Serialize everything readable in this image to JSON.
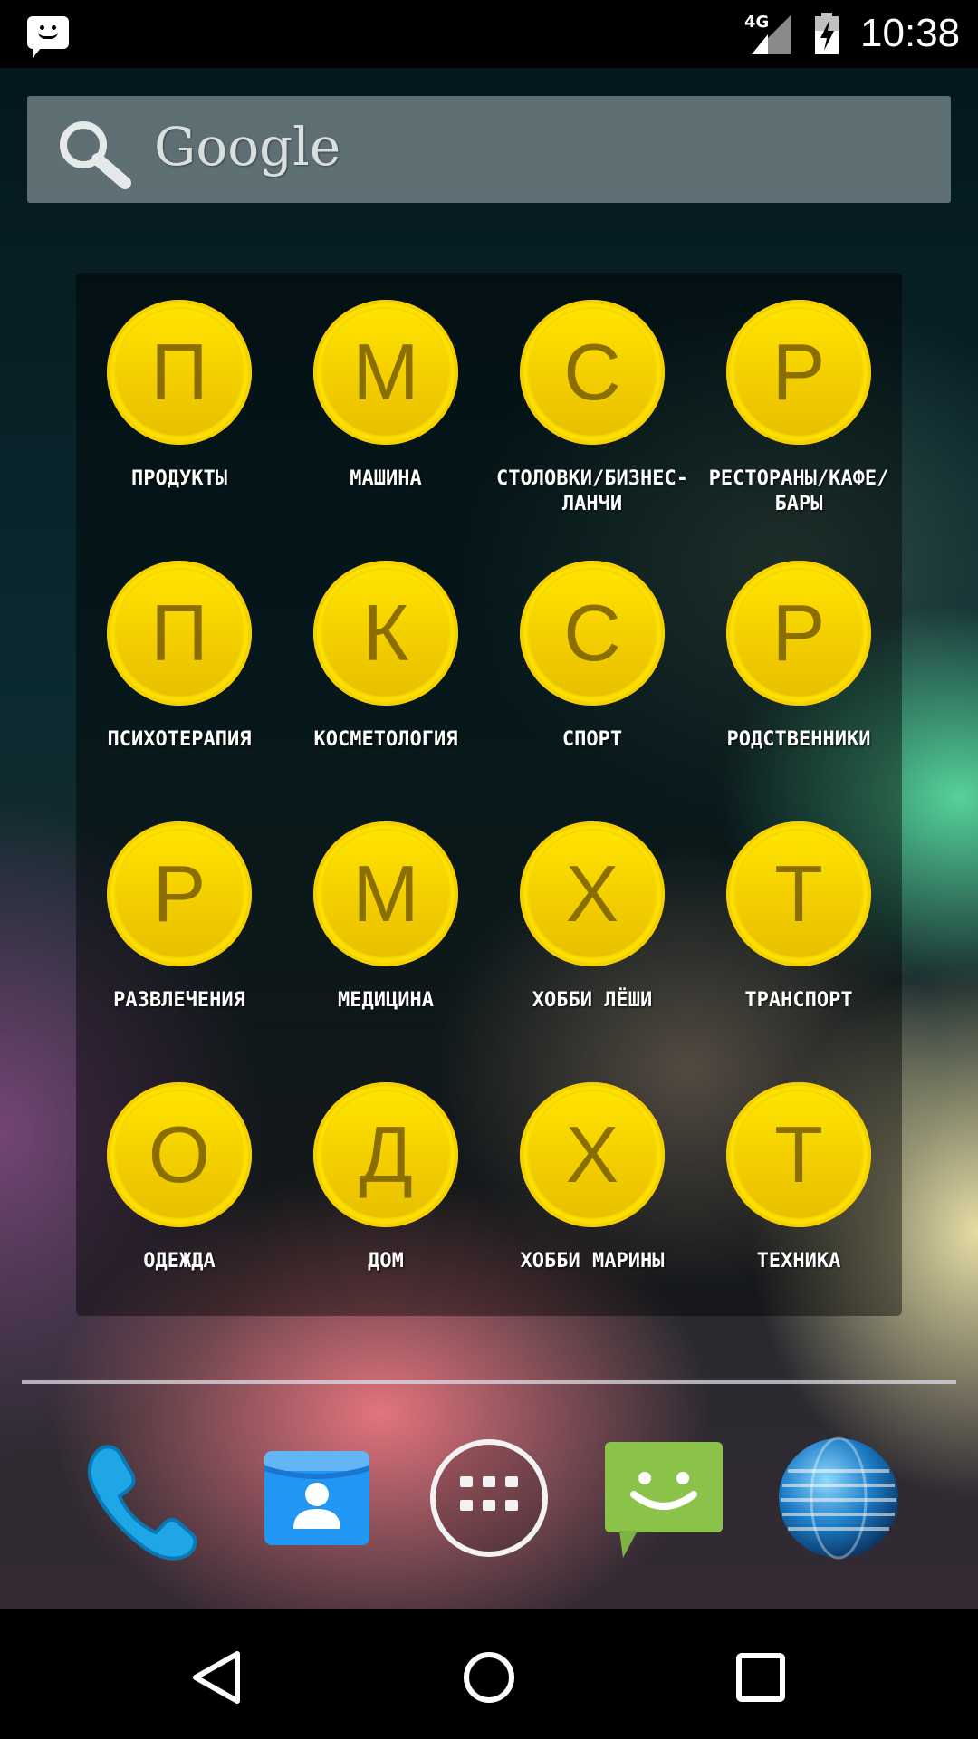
{
  "status_bar": {
    "network": "4G",
    "time": "10:38",
    "notification_icon": "message-icon",
    "signal_icon": "signal-icon",
    "battery_icon": "battery-charging-icon"
  },
  "search": {
    "label": "Google",
    "icon": "search-icon"
  },
  "folder": {
    "accent_color": "#ffe100",
    "apps": [
      {
        "letter": "П",
        "label": "ПРОДУКТЫ"
      },
      {
        "letter": "М",
        "label": "МАШИНА"
      },
      {
        "letter": "С",
        "label": "СТОЛОВКИ/БИЗНЕС-\nЛАНЧИ"
      },
      {
        "letter": "Р",
        "label": "РЕСТОРАНЫ/КАФЕ/\nБАРЫ"
      },
      {
        "letter": "П",
        "label": "ПСИХОТЕРАПИЯ"
      },
      {
        "letter": "К",
        "label": "КОСМЕТОЛОГИЯ"
      },
      {
        "letter": "С",
        "label": "СПОРТ"
      },
      {
        "letter": "Р",
        "label": "РОДСТВЕННИКИ"
      },
      {
        "letter": "Р",
        "label": "РАЗВЛЕЧЕНИЯ"
      },
      {
        "letter": "М",
        "label": "МЕДИЦИНА"
      },
      {
        "letter": "Х",
        "label": "ХОББИ ЛЁШИ"
      },
      {
        "letter": "Т",
        "label": "ТРАНСПОРТ"
      },
      {
        "letter": "О",
        "label": "ОДЕЖДА"
      },
      {
        "letter": "Д",
        "label": "ДОМ"
      },
      {
        "letter": "Х",
        "label": "ХОББИ МАРИНЫ"
      },
      {
        "letter": "Т",
        "label": "ТЕХНИКА"
      }
    ]
  },
  "dock": {
    "items": [
      "phone-icon",
      "contacts-icon",
      "app-drawer-icon",
      "messaging-icon",
      "browser-globe-icon"
    ]
  },
  "nav_bar": {
    "items": [
      "back-icon",
      "home-icon",
      "recents-icon"
    ]
  }
}
